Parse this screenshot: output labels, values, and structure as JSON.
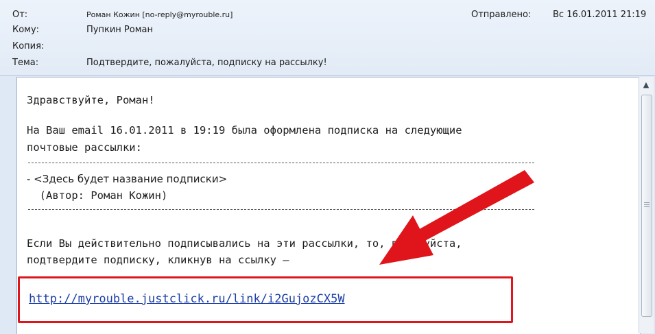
{
  "header": {
    "from_label": "От:",
    "from_value": "Роман Кожин [no-reply@myrouble.ru]",
    "sent_label": "Отправлено:",
    "sent_value": "Вс 16.01.2011 21:19",
    "to_label": "Кому:",
    "to_value": "Пупкин Роман",
    "cc_label": "Копия:",
    "cc_value": "",
    "subject_label": "Тема:",
    "subject_value": "Подтвердите, пожалуйста, подписку на рассылку!"
  },
  "message": {
    "greeting": "Здравствуйте, Роман!",
    "line1": "На Ваш email 16.01.2011 в 19:19 была оформлена подписка на следующие",
    "line2": "почтовые рассылки:",
    "sub_name": "- <Здесь будет название подписки>",
    "sub_author": "  (Автор: Роман Кожин)",
    "confirm1": "Если Вы действительно подписывались на эти рассылки, то, пожалуйста,",
    "confirm2": "подтвердите подписку, кликнув на ссылку –",
    "link": "http://myrouble.justclick.ru/link/i2GujozCX5W"
  },
  "icons": {
    "scroll_up": "scroll-up-arrow-icon",
    "annotation": "red-arrow-icon"
  },
  "colors": {
    "annotation": "#e0141b",
    "link": "#1d3fa6"
  }
}
